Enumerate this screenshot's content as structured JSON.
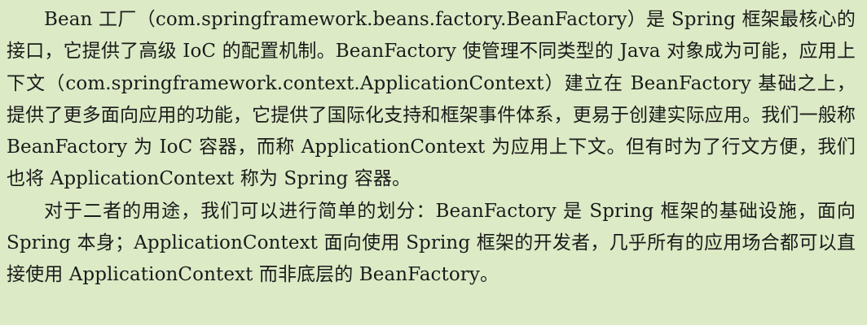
{
  "document": {
    "paragraphs": [
      "Bean 工厂（com.springframework.beans.factory.BeanFactory）是 Spring 框架最核心的接口，它提供了高级 IoC 的配置机制。BeanFactory 使管理不同类型的 Java 对象成为可能，应用上下文（com.springframework.context.ApplicationContext）建立在 BeanFactory 基础之上，提供了更多面向应用的功能，它提供了国际化支持和框架事件体系，更易于创建实际应用。我们一般称 BeanFactory 为 IoC 容器，而称 ApplicationContext 为应用上下文。但有时为了行文方便，我们也将 ApplicationContext 称为 Spring 容器。",
      "对于二者的用途，我们可以进行简单的划分：BeanFactory 是 Spring 框架的基础设施，面向 Spring 本身；ApplicationContext 面向使用 Spring 框架的开发者，几乎所有的应用场合都可以直接使用 ApplicationContext 而非底层的 BeanFactory。"
    ]
  },
  "colors": {
    "background": "#dcebc6",
    "text": "#1b1b1b"
  }
}
